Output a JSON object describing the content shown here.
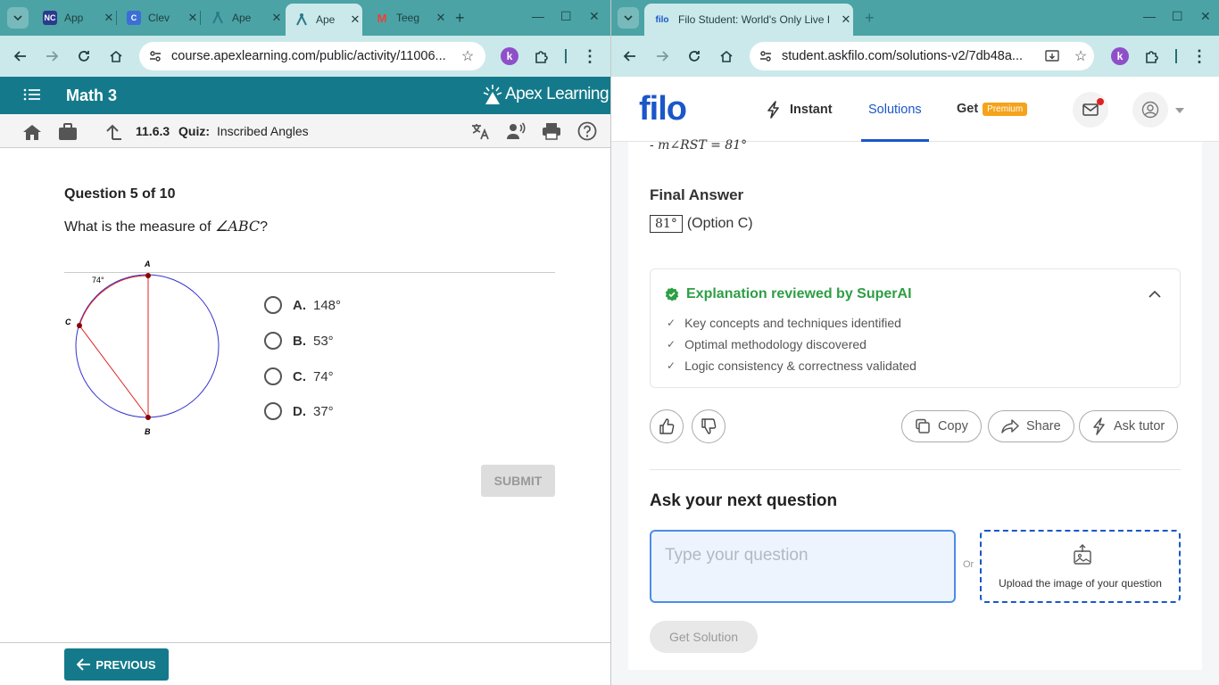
{
  "left_browser": {
    "tabs": [
      {
        "label": "App",
        "favicon_text": "NC",
        "favicon_color": "#2a3a8c"
      },
      {
        "label": "Clev",
        "favicon_text": "C",
        "favicon_color": "#3b6fd6"
      },
      {
        "label": "Ape",
        "favicon_text": "",
        "favicon_color": "#4ba3a5"
      },
      {
        "label": "Ape",
        "favicon_text": "",
        "favicon_color": "#4ba3a5"
      },
      {
        "label": "Teeg",
        "favicon_text": "M",
        "favicon_color": "#ea4335"
      }
    ],
    "url": "course.apexlearning.com/public/activity/11006..."
  },
  "right_browser": {
    "tab_title": "Filo Student: World's Only Live I",
    "tab_favicon": "filo",
    "url": "student.askfilo.com/solutions-v2/7db48a..."
  },
  "apex": {
    "course": "Math 3",
    "brand": "Apex Learning",
    "activity_code": "11.6.3",
    "activity_type": "Quiz:",
    "activity_name": "Inscribed Angles",
    "question_header": "Question 5 of 10",
    "question_prefix": "What is the measure of ",
    "question_angle": "ABC",
    "question_suffix": "?",
    "diagram": {
      "label_a": "A",
      "label_b": "B",
      "label_c": "C",
      "arc_label": "74°"
    },
    "options": [
      {
        "letter": "A.",
        "text": "148°"
      },
      {
        "letter": "B.",
        "text": "53°"
      },
      {
        "letter": "C.",
        "text": "74°"
      },
      {
        "letter": "D.",
        "text": "37°"
      }
    ],
    "submit_label": "SUBMIT",
    "previous_label": "PREVIOUS"
  },
  "filo": {
    "logo": "filo",
    "nav": {
      "instant": "Instant",
      "solutions": "Solutions",
      "get": "Get",
      "premium": "Premium"
    },
    "partial_line": "- m∠RST = 81°",
    "final_answer_title": "Final Answer",
    "final_answer_boxed": "81°",
    "final_answer_option": "(Option C)",
    "review_title": "Explanation reviewed by SuperAI",
    "review_items": [
      "Key concepts and techniques identified",
      "Optimal methodology discovered",
      "Logic consistency & correctness validated"
    ],
    "copy_label": "Copy",
    "share_label": "Share",
    "ask_tutor_label": "Ask tutor",
    "next_question_title": "Ask your next question",
    "question_placeholder": "Type your question",
    "or_label": "Or",
    "upload_label": "Upload the image of your question",
    "get_solution_label": "Get Solution"
  },
  "colors": {
    "apex_teal": "#147a8b",
    "filo_blue": "#1a57c9",
    "superai_green": "#2e9e44",
    "premium_orange": "#f5a31b"
  }
}
